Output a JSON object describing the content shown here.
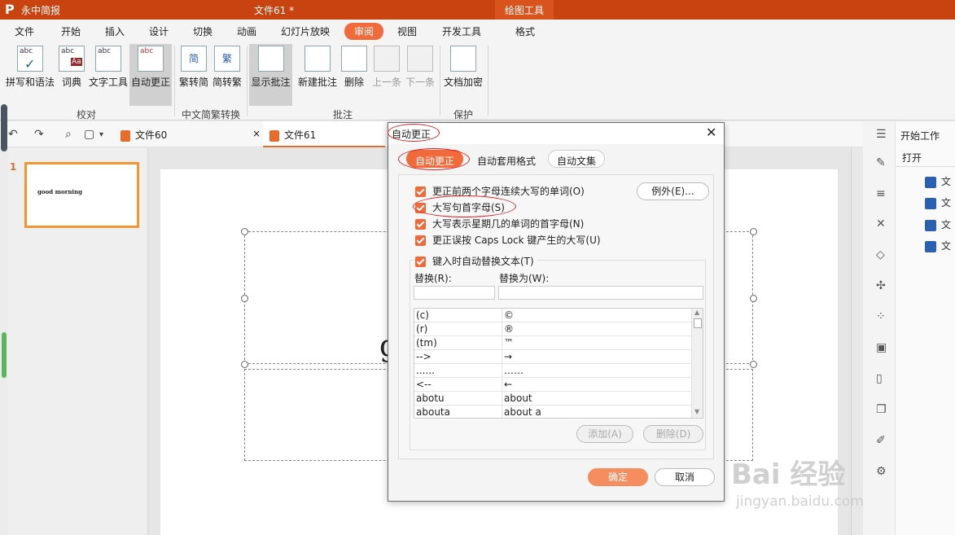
{
  "app": {
    "logo": "P",
    "name": "永中简报",
    "doc_title": "文件61 *",
    "drawing_tools": "绘图工具"
  },
  "menu": {
    "items": [
      "文件",
      "开始",
      "插入",
      "设计",
      "切换",
      "动画",
      "幻灯片放映",
      "审阅",
      "视图",
      "开发工具",
      "格式"
    ]
  },
  "ribbon": {
    "buttons": [
      "拼写和语法",
      "词典",
      "文字工具",
      "自动更正",
      "繁转简",
      "简转繁",
      "显示批注",
      "新建批注",
      "删除",
      "上一条",
      "下一条",
      "文档加密"
    ],
    "icon_text": {
      "spell": "abc",
      "dict": "abc",
      "dict_sub": "Aa",
      "texttool": "abc",
      "autocorrect": "abc",
      "t2s": "简",
      "s2t": "繁"
    },
    "groups": [
      "校对",
      "中文简繁转换",
      "批注",
      "保护"
    ]
  },
  "tabs": {
    "file60": "文件60",
    "file61": "文件61",
    "close": "×"
  },
  "thumbnail": {
    "number": "1",
    "text": "good morning"
  },
  "canvas": {
    "partial_text": "g"
  },
  "task_pane": {
    "title": "开始工作",
    "open": "打开",
    "files": [
      "文",
      "文",
      "文",
      "文"
    ]
  },
  "watermark": {
    "line1": "Bai 经验",
    "line2": "jingyan.baidu.com"
  },
  "dialog": {
    "title": "自动更正",
    "close": "✕",
    "tabs": [
      "自动更正",
      "自动套用格式",
      "自动文集"
    ],
    "options": [
      "更正前两个字母连续大写的单词(O)",
      "大写句首字母(S)",
      "大写表示星期几的单词的首字母(N)",
      "更正误按 Caps Lock 键产生的大写(U)",
      "键入时自动替换文本(T)"
    ],
    "exceptions_btn": "例外(E)...",
    "replace_label": "替换(R):",
    "with_label": "替换为(W):",
    "rows": [
      {
        "from": "(c)",
        "to": "©"
      },
      {
        "from": "(r)",
        "to": "®"
      },
      {
        "from": "(tm)",
        "to": "™"
      },
      {
        "from": "-->",
        "to": "→"
      },
      {
        "from": "......",
        "to": "……"
      },
      {
        "from": "<--",
        "to": "←"
      },
      {
        "from": "abotu",
        "to": "about"
      },
      {
        "from": "abouta",
        "to": "about a"
      }
    ],
    "add_btn": "添加(A)",
    "delete_btn": "删除(D)",
    "ok_btn": "确定",
    "cancel_btn": "取消"
  },
  "colors": {
    "accent": "#f06a3c",
    "titlebar": "#c84310",
    "annotation": "#dd2222"
  }
}
